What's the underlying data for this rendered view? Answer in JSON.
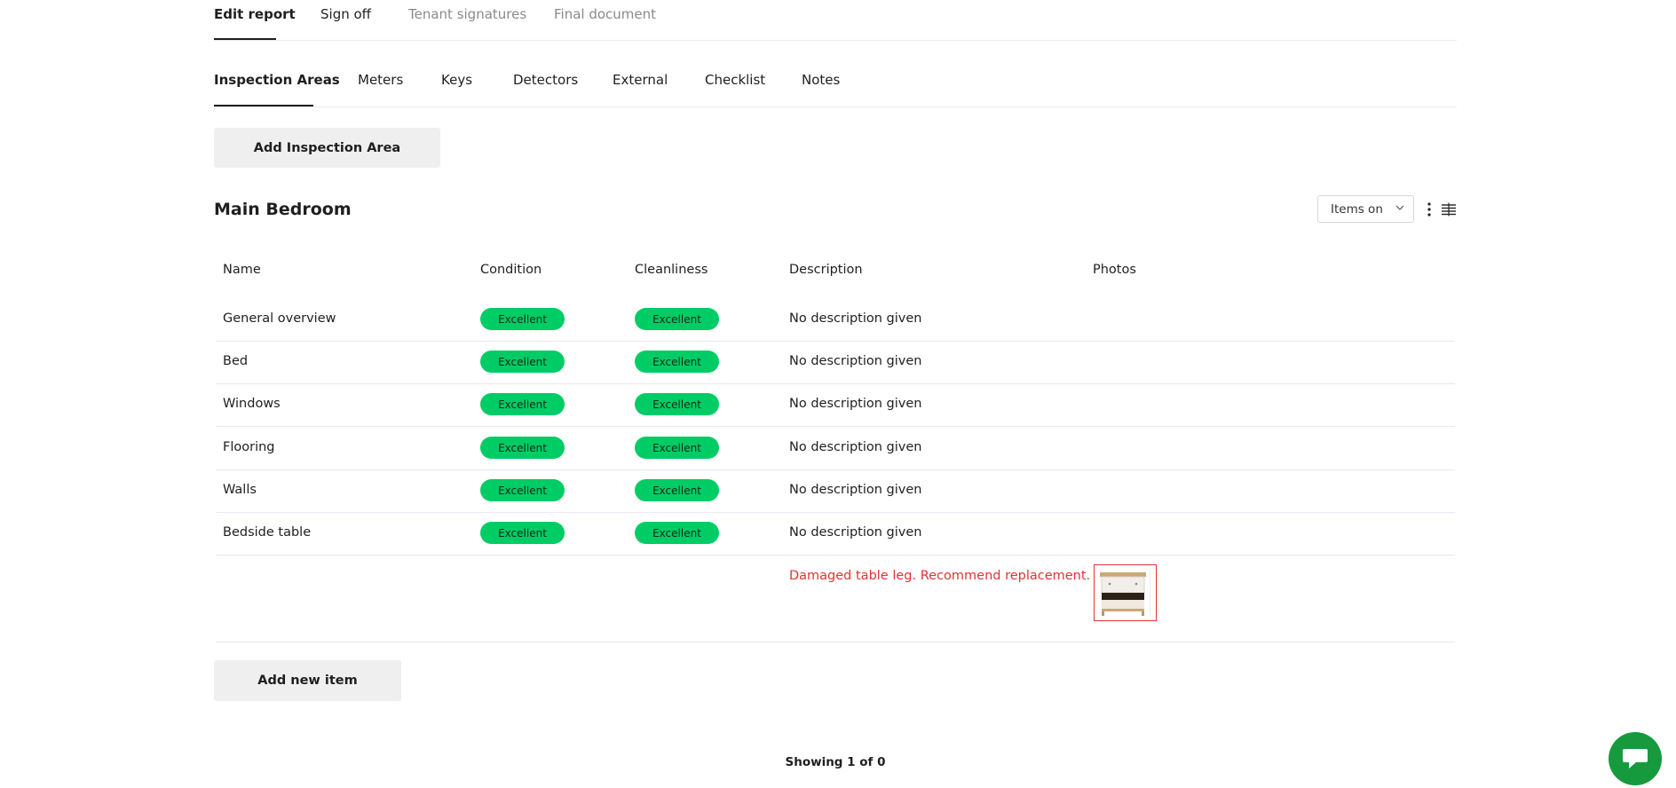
{
  "top_tabs": [
    {
      "label": "Edit report"
    },
    {
      "label": "Sign off"
    },
    {
      "label": "Tenant signatures"
    },
    {
      "label": "Final document"
    }
  ],
  "sub_tabs": [
    {
      "label": "Inspection Areas"
    },
    {
      "label": "Meters"
    },
    {
      "label": "Keys"
    },
    {
      "label": "Detectors"
    },
    {
      "label": "External"
    },
    {
      "label": "Checklist"
    },
    {
      "label": "Notes"
    }
  ],
  "add_area_label": "Add Inspection Area",
  "area": {
    "title": "Main Bedroom",
    "items_select": "Items on"
  },
  "table": {
    "headers": [
      "Name",
      "Condition",
      "Cleanliness",
      "Description",
      "Photos"
    ],
    "rows": [
      {
        "name": "General overview",
        "condition": "Excellent",
        "cleanliness": "Excellent",
        "description": "No description given"
      },
      {
        "name": "Bed",
        "condition": "Excellent",
        "cleanliness": "Excellent",
        "description": "No description given"
      },
      {
        "name": "Windows",
        "condition": "Excellent",
        "cleanliness": "Excellent",
        "description": "No description given"
      },
      {
        "name": "Flooring",
        "condition": "Excellent",
        "cleanliness": "Excellent",
        "description": "No description given"
      },
      {
        "name": "Walls",
        "condition": "Excellent",
        "cleanliness": "Excellent",
        "description": "No description given"
      },
      {
        "name": "Bedside table",
        "condition": "Excellent",
        "cleanliness": "Excellent",
        "description": "No description given"
      }
    ],
    "note": "Damaged table leg. Recommend replacement."
  },
  "add_item_label": "Add new item",
  "paging": "Showing 1 of 0",
  "colors": {
    "badge_green": "#00cc66",
    "note_red": "#e03333",
    "chat_green": "#179a3d"
  },
  "icons": [
    "chevron-down-icon",
    "kebab-menu-icon",
    "compact-rows-icon",
    "chat-icon"
  ]
}
